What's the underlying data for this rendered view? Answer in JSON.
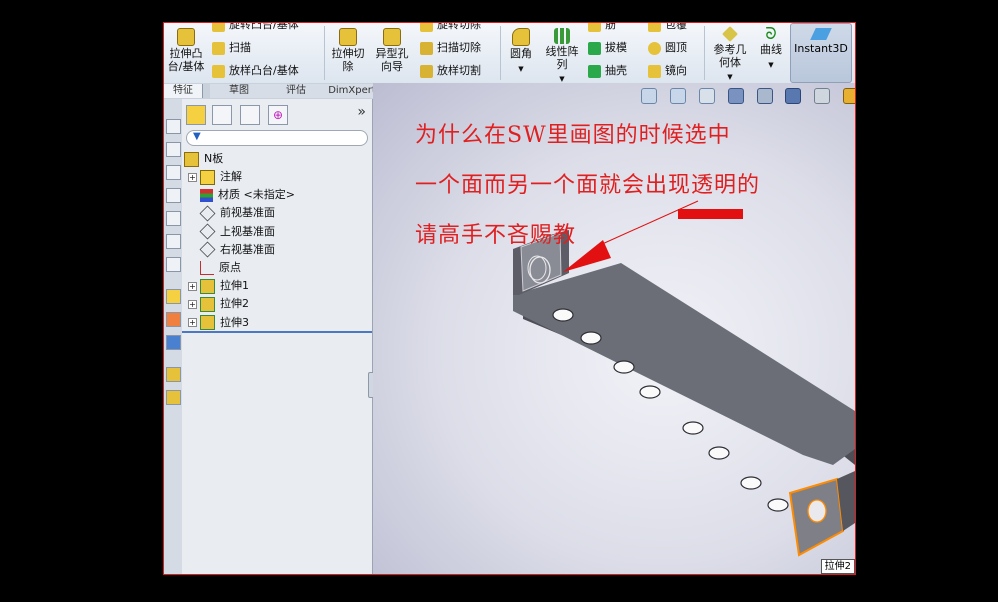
{
  "ribbon": {
    "extrude_boss": "拉伸凸\n台/基体",
    "revolve_boss": "旋转凸台/基体",
    "sweep": "扫描",
    "loft_boss": "放样凸台/基体",
    "extrude_cut": "拉伸切\n除",
    "hole_wizard": "异型孔\n向导",
    "revolve_cut": "旋转切除",
    "sweep_cut": "扫描切除",
    "loft_cut": "放样切割",
    "fillet": "圆角",
    "linear_pattern": "线性阵\n列",
    "rib": "筋",
    "draft": "拔模",
    "shell": "抽壳",
    "wrap": "包覆",
    "dome": "圆顶",
    "mirror": "镜向",
    "ref_geometry": "参考几\n何体",
    "curves": "曲线",
    "instant3d": "Instant3D"
  },
  "tabs": [
    "特征",
    "草图",
    "评估",
    "DimXpert"
  ],
  "tree": {
    "root": "N板",
    "items": [
      {
        "label": "注解",
        "expand": "+",
        "icon": "annotation-icon"
      },
      {
        "label": "材质 <未指定>",
        "expand": "",
        "icon": "material-icon"
      },
      {
        "label": "前视基准面",
        "expand": "",
        "icon": "plane-icon"
      },
      {
        "label": "上视基准面",
        "expand": "",
        "icon": "plane-icon"
      },
      {
        "label": "右视基准面",
        "expand": "",
        "icon": "plane-icon"
      },
      {
        "label": "原点",
        "expand": "",
        "icon": "origin-icon"
      },
      {
        "label": "拉伸1",
        "expand": "+",
        "icon": "extrude-feature-icon"
      },
      {
        "label": "拉伸2",
        "expand": "+",
        "icon": "extrude-feature-icon"
      },
      {
        "label": "拉伸3",
        "expand": "+",
        "icon": "extrude-feature-icon"
      }
    ],
    "panel_more": "»"
  },
  "annotation": {
    "line1": "为什么在SW里画图的时候选中",
    "line2": "一个面而另一个面就会出现透明的",
    "line3": "请高手不吝赐教"
  },
  "tooltip": "拉伸2",
  "colors": {
    "annotation": "#e02020",
    "selection": "#ff8c00",
    "part": "#6e7079"
  }
}
